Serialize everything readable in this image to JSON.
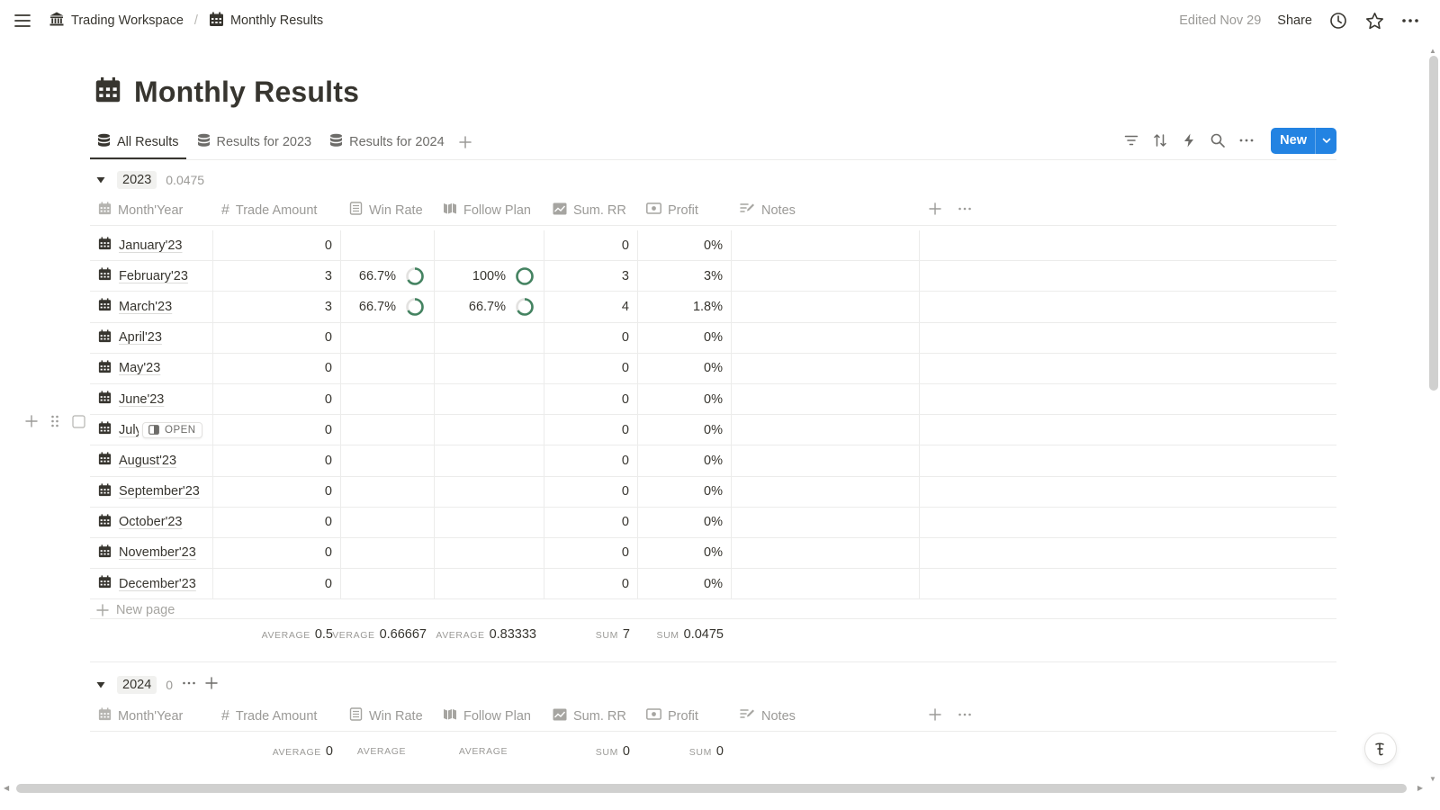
{
  "topbar": {
    "breadcrumbs": [
      "Trading Workspace",
      "Monthly Results"
    ],
    "separator": "/",
    "edited": "Edited Nov 29",
    "share": "Share"
  },
  "page": {
    "title": "Monthly Results"
  },
  "tabs": [
    "All Results",
    "Results for 2023",
    "Results for 2024"
  ],
  "new_button": "New",
  "columns": [
    "Month'Year",
    "Trade Amount",
    "Win Rate",
    "Follow Plan",
    "Sum. RR",
    "Profit",
    "Notes"
  ],
  "group_2023": {
    "label": "2023",
    "value": "0.0475",
    "rows": [
      {
        "name": "January'23",
        "trade": "0",
        "win": "",
        "follow": "",
        "sumrr": "0",
        "profit": "0%"
      },
      {
        "name": "February'23",
        "trade": "3",
        "win": "66.7%",
        "follow": "100%",
        "sumrr": "3",
        "profit": "3%"
      },
      {
        "name": "March'23",
        "trade": "3",
        "win": "66.7%",
        "follow": "66.7%",
        "sumrr": "4",
        "profit": "1.8%"
      },
      {
        "name": "April'23",
        "trade": "0",
        "win": "",
        "follow": "",
        "sumrr": "0",
        "profit": "0%"
      },
      {
        "name": "May'23",
        "trade": "0",
        "win": "",
        "follow": "",
        "sumrr": "0",
        "profit": "0%"
      },
      {
        "name": "June'23",
        "trade": "0",
        "win": "",
        "follow": "",
        "sumrr": "0",
        "profit": "0%"
      },
      {
        "name": "July'23",
        "trade": "0",
        "win": "",
        "follow": "",
        "sumrr": "0",
        "profit": "0%"
      },
      {
        "name": "August'23",
        "trade": "0",
        "win": "",
        "follow": "",
        "sumrr": "0",
        "profit": "0%"
      },
      {
        "name": "September'23",
        "trade": "0",
        "win": "",
        "follow": "",
        "sumrr": "0",
        "profit": "0%"
      },
      {
        "name": "October'23",
        "trade": "0",
        "win": "",
        "follow": "",
        "sumrr": "0",
        "profit": "0%"
      },
      {
        "name": "November'23",
        "trade": "0",
        "win": "",
        "follow": "",
        "sumrr": "0",
        "profit": "0%"
      },
      {
        "name": "December'23",
        "trade": "0",
        "win": "",
        "follow": "",
        "sumrr": "0",
        "profit": "0%"
      }
    ],
    "new_page": "New page",
    "calc": [
      {
        "label": "AVERAGE",
        "value": "0.5"
      },
      {
        "label": "VERAGE",
        "value": "0.66667"
      },
      {
        "label": "AVERAGE",
        "value": "0.83333"
      },
      {
        "label": "SUM",
        "value": "7"
      },
      {
        "label": "SUM",
        "value": "0.0475"
      }
    ]
  },
  "group_2024": {
    "label": "2024",
    "value": "0",
    "calc": [
      {
        "label": "AVERAGE",
        "value": "0"
      },
      {
        "label": "AVERAGE",
        "value": ""
      },
      {
        "label": "AVERAGE",
        "value": ""
      },
      {
        "label": "SUM",
        "value": "0"
      },
      {
        "label": "SUM",
        "value": "0"
      }
    ]
  },
  "open_chip": "OPEN",
  "colors": {
    "accent": "#2383e2",
    "ring": "#448361",
    "text": "#37352f",
    "muted": "#9b9a97"
  }
}
